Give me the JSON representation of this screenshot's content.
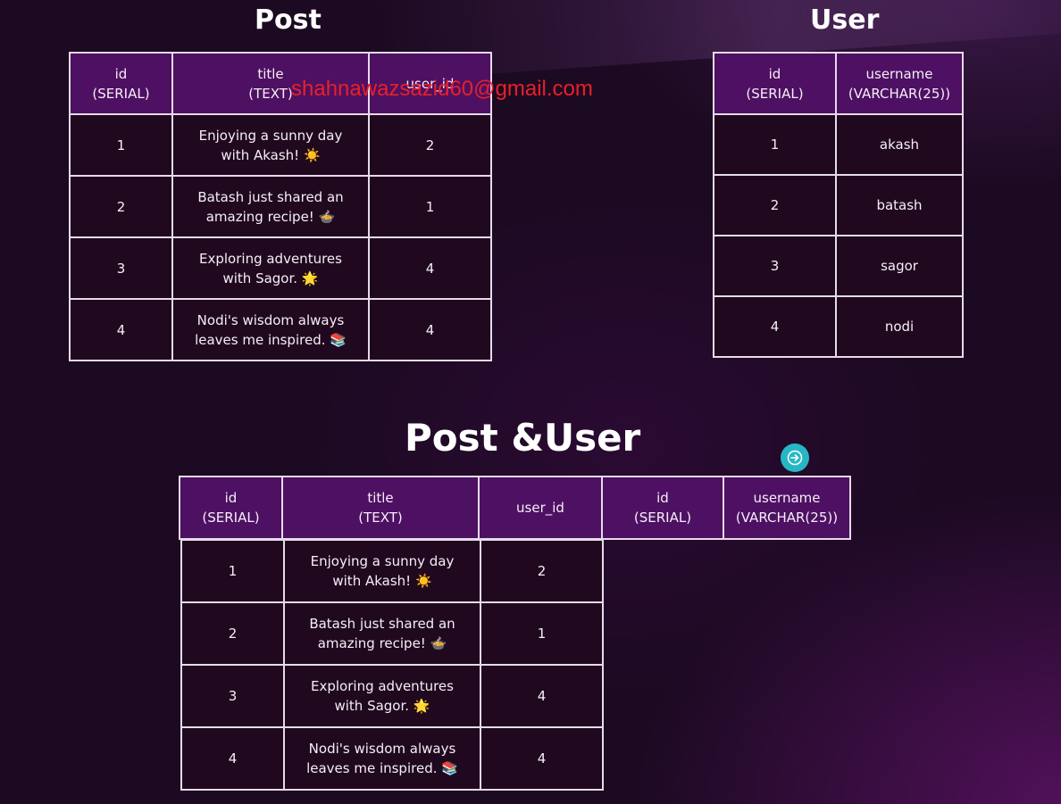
{
  "post": {
    "title": "Post",
    "headers": [
      {
        "line1": "id",
        "line2": "(SERIAL)"
      },
      {
        "line1": "title",
        "line2": "(TEXT)"
      },
      {
        "line1": "user_id",
        "line2": ""
      }
    ],
    "rows": [
      {
        "id": "1",
        "title_line1": "Enjoying a sunny day",
        "title_line2": "with Akash! ☀️",
        "user_id": "2"
      },
      {
        "id": "2",
        "title_line1": "Batash just shared an",
        "title_line2": "amazing recipe! 🍲",
        "user_id": "1"
      },
      {
        "id": "3",
        "title_line1": "Exploring adventures",
        "title_line2": "with Sagor. 🌟",
        "user_id": "4"
      },
      {
        "id": "4",
        "title_line1": "Nodi's wisdom always",
        "title_line2": "leaves me inspired. 📚",
        "user_id": "4"
      }
    ]
  },
  "user": {
    "title": "User",
    "headers": [
      {
        "line1": "id",
        "line2": "(SERIAL)"
      },
      {
        "line1": "username",
        "line2": "(VARCHAR(25))"
      }
    ],
    "rows": [
      {
        "id": "1",
        "username": "akash"
      },
      {
        "id": "2",
        "username": "batash"
      },
      {
        "id": "3",
        "username": "sagor"
      },
      {
        "id": "4",
        "username": "nodi"
      }
    ]
  },
  "join": {
    "title": "Post &User",
    "headers": [
      {
        "line1": "id",
        "line2": "(SERIAL)"
      },
      {
        "line1": "title",
        "line2": "(TEXT)"
      },
      {
        "line1": "user_id",
        "line2": ""
      },
      {
        "line1": "id",
        "line2": "(SERIAL)"
      },
      {
        "line1": "username",
        "line2": "(VARCHAR(25))"
      }
    ],
    "rows": [
      {
        "id": "1",
        "title_line1": "Enjoying a sunny day",
        "title_line2": "with Akash! ☀️",
        "user_id": "2"
      },
      {
        "id": "2",
        "title_line1": "Batash just shared an",
        "title_line2": "amazing recipe! 🍲",
        "user_id": "1"
      },
      {
        "id": "3",
        "title_line1": "Exploring adventures",
        "title_line2": "with Sagor. 🌟",
        "user_id": "4"
      },
      {
        "id": "4",
        "title_line1": "Nodi's wisdom always",
        "title_line2": "leaves me inspired. 📚",
        "user_id": "4"
      }
    ]
  },
  "watermark": "shahnawazsazid60@gmail.com",
  "nav_button": {
    "icon": "arrow-right-circle-icon",
    "color": "#27b7c4"
  },
  "colors": {
    "header_fill": "#4e1062",
    "cell_fill": "#20091f",
    "border": "#e6dbe9",
    "watermark": "#e8202a"
  }
}
